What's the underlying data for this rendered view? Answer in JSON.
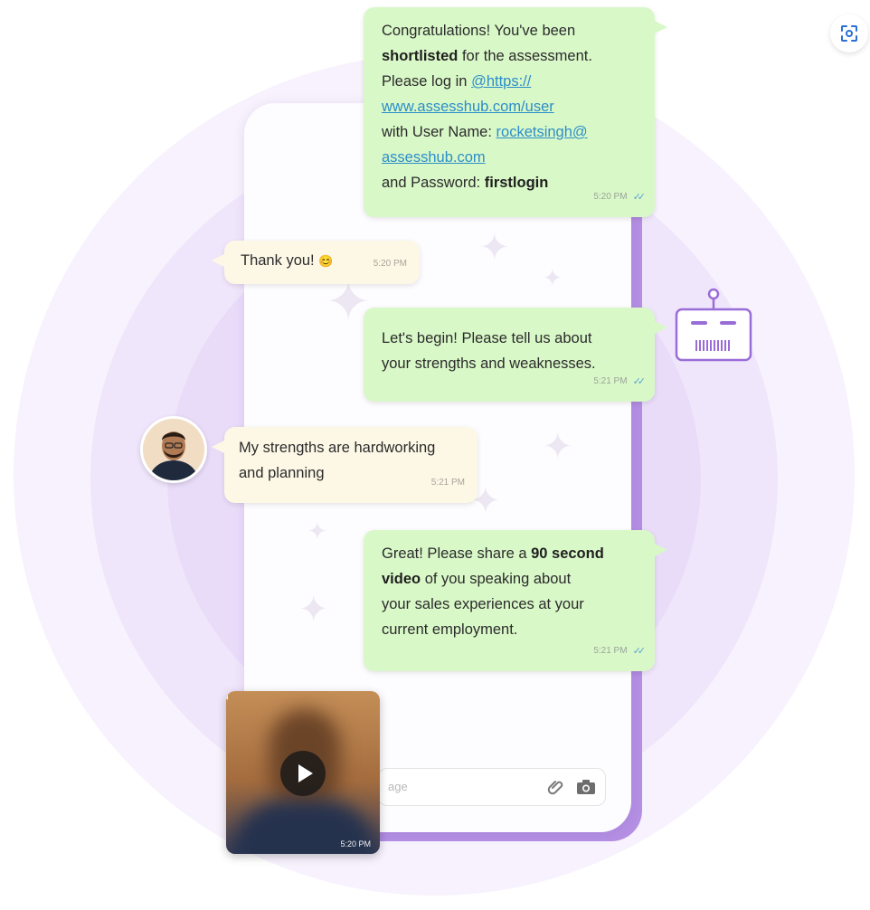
{
  "messages": {
    "m1": {
      "line1": "Congratulations! You've been",
      "bold1": "shortlisted",
      "line2_rest": " for the assessment.",
      "line3": "Please log in ",
      "link_a": "@https://",
      "link_b": "www.assesshub.com/user",
      "line5": "with User Name: ",
      "link_c": "rocketsingh@",
      "link_d": "assesshub.com",
      "line7": "and Password: ",
      "bold2": "firstlogin",
      "time": "5:20 PM"
    },
    "m2": {
      "text": "Thank you! ",
      "emoji": "😊",
      "time": "5:20 PM"
    },
    "m3": {
      "line1": "Let's begin! Please tell us about",
      "line2": "your strengths and weaknesses.",
      "time": "5:21 PM"
    },
    "m4": {
      "line1": "My strengths are hardworking",
      "line2": "and planning",
      "time": "5:21 PM"
    },
    "m5": {
      "pre": "Great! Please share a ",
      "bold_a": "90 second",
      "bold_b": "video",
      "post": " of you speaking about",
      "line3": "your sales experiences at your",
      "line4": "current employment.",
      "time": "5:21 PM"
    }
  },
  "video": {
    "time": "5:20 PM"
  },
  "composer": {
    "placeholder": "age"
  },
  "icons": {
    "attach": "paperclip-icon",
    "camera": "camera-icon",
    "play": "play-icon",
    "robot": "robot-icon",
    "read": "double-check-icon",
    "scan": "scan-icon"
  },
  "colors": {
    "bot_bubble": "#d9f8c8",
    "user_bubble": "#fdf8e6",
    "accent": "#b48fe3",
    "link": "#2c8ec9"
  }
}
